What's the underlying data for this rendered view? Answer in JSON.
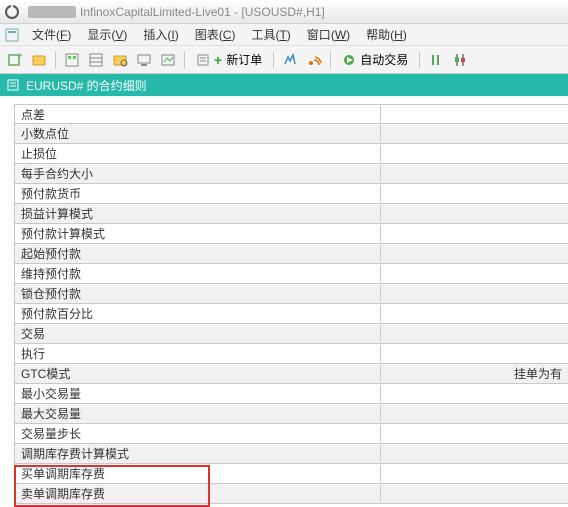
{
  "titlebar": {
    "app_title": "InfinoxCapitalLimited-Live01 - [USOUSD#,H1]"
  },
  "menu": {
    "items": [
      {
        "label": "文件",
        "key": "F"
      },
      {
        "label": "显示",
        "key": "V"
      },
      {
        "label": "插入",
        "key": "I"
      },
      {
        "label": "图表",
        "key": "C"
      },
      {
        "label": "工具",
        "key": "T"
      },
      {
        "label": "窗口",
        "key": "W"
      },
      {
        "label": "帮助",
        "key": "H"
      }
    ]
  },
  "toolbar": {
    "new_order": "新订单",
    "auto_trade": "自动交易"
  },
  "panel": {
    "title": "EURUSD# 的合约细则"
  },
  "rows": [
    {
      "label": "点差",
      "value": ""
    },
    {
      "label": "小数点位",
      "value": ""
    },
    {
      "label": "止损位",
      "value": ""
    },
    {
      "label": "每手合约大小",
      "value": ""
    },
    {
      "label": "预付款货币",
      "value": ""
    },
    {
      "label": "损益计算模式",
      "value": ""
    },
    {
      "label": "预付款计算模式",
      "value": ""
    },
    {
      "label": "起始预付款",
      "value": ""
    },
    {
      "label": "维持预付款",
      "value": ""
    },
    {
      "label": "锁仓预付款",
      "value": ""
    },
    {
      "label": "预付款百分比",
      "value": ""
    },
    {
      "label": "交易",
      "value": ""
    },
    {
      "label": "执行",
      "value": ""
    },
    {
      "label": "GTC模式",
      "value": "挂单为有"
    },
    {
      "label": "最小交易量",
      "value": ""
    },
    {
      "label": "最大交易量",
      "value": ""
    },
    {
      "label": "交易量步长",
      "value": ""
    },
    {
      "label": "调期库存费计算模式",
      "value": ""
    },
    {
      "label": "买单调期库存费",
      "value": ""
    },
    {
      "label": "卖单调期库存费",
      "value": ""
    }
  ]
}
